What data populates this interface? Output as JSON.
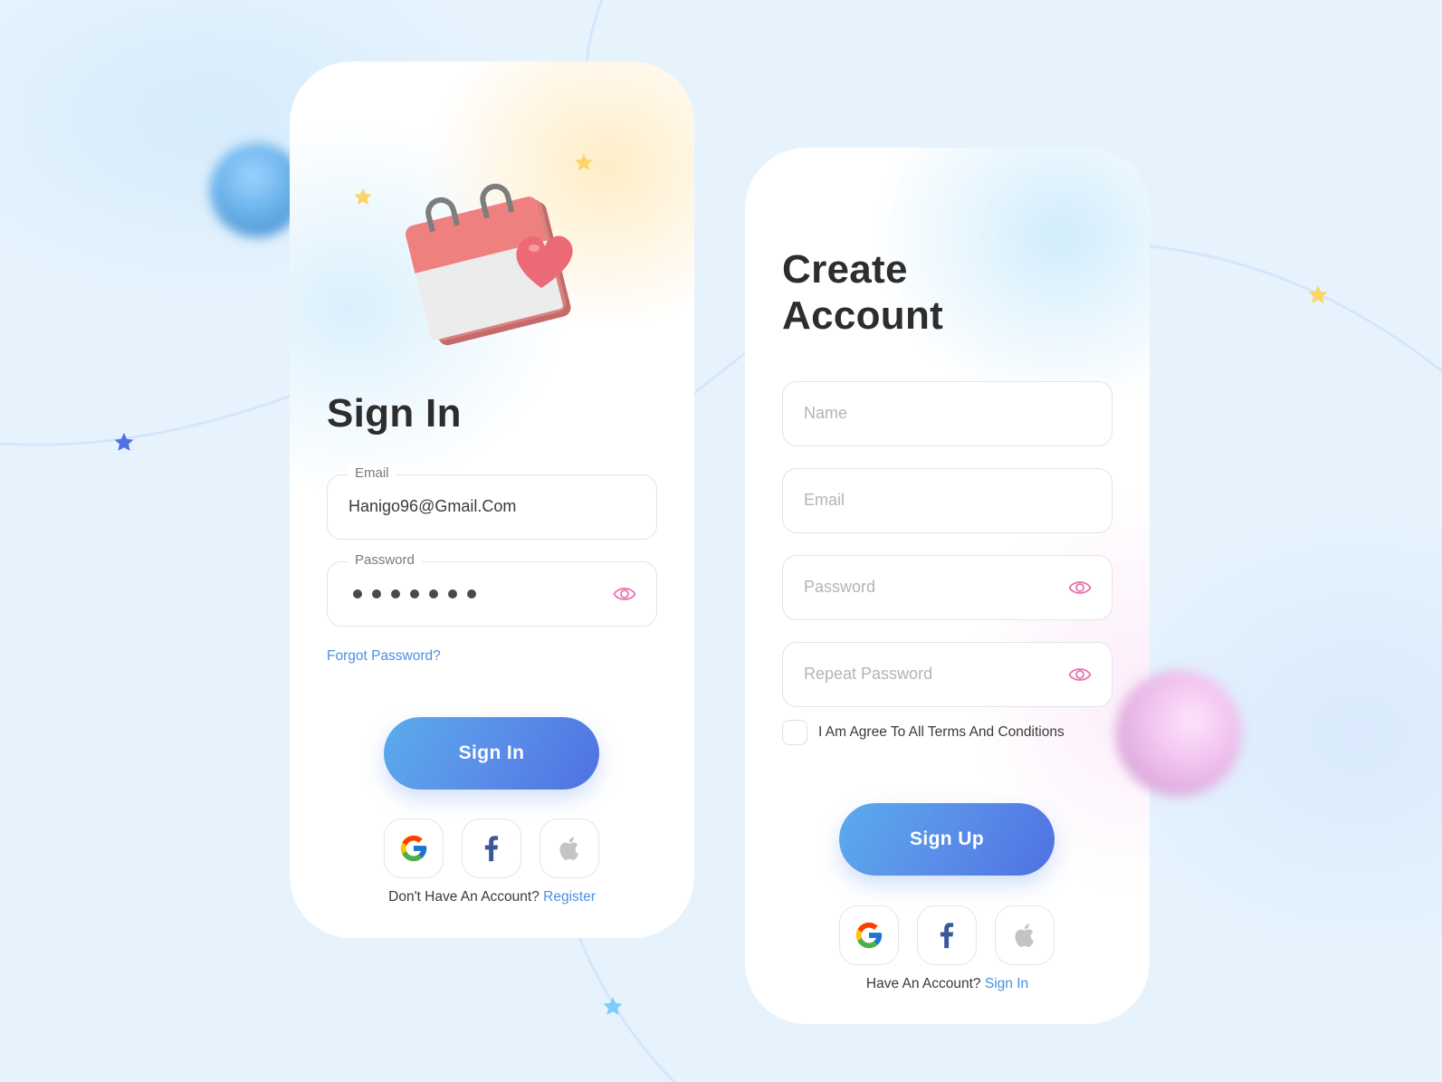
{
  "theme": {
    "accent": "#4f71e3",
    "accent_light": "#5aaced",
    "link": "#4a90e2",
    "eye_icon": "#ec6fb0",
    "heading": "#2d2d2d",
    "background": "#e6f3fd"
  },
  "signin": {
    "title": "Sign In",
    "email": {
      "label": "Email",
      "value": "Hanigo96@Gmail.Com"
    },
    "password": {
      "label": "Password",
      "masked_length": 7,
      "visibility_icon": "eye-icon"
    },
    "forgot_password": "Forgot Password?",
    "submit_label": "Sign In",
    "social": [
      {
        "name": "Google",
        "icon": "google-icon"
      },
      {
        "name": "Facebook",
        "icon": "facebook-icon"
      },
      {
        "name": "Apple",
        "icon": "apple-icon"
      }
    ],
    "footer_text": "Don't Have An Account?",
    "footer_link": "Register"
  },
  "signup": {
    "title_line1": "Create",
    "title_line2": "Account",
    "fields": [
      {
        "placeholder": "Name",
        "has_eye": false
      },
      {
        "placeholder": "Email",
        "has_eye": false
      },
      {
        "placeholder": "Password",
        "has_eye": true
      },
      {
        "placeholder": "Repeat Password",
        "has_eye": true
      }
    ],
    "terms_label": "I Am Agree To All Terms And Conditions",
    "terms_checked": false,
    "submit_label": "Sign Up",
    "social": [
      {
        "name": "Google",
        "icon": "google-icon"
      },
      {
        "name": "Facebook",
        "icon": "facebook-icon"
      },
      {
        "name": "Apple",
        "icon": "apple-icon"
      }
    ],
    "footer_text": "Have An Account?",
    "footer_link": "Sign In"
  }
}
